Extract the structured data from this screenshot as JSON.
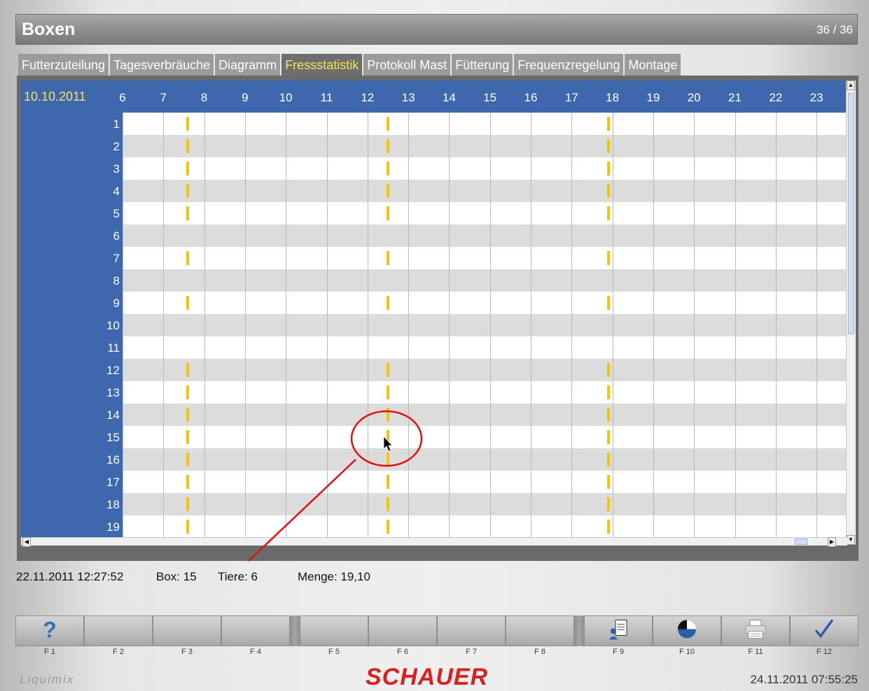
{
  "window": {
    "title": "Boxen",
    "page_indicator": "36 / 36"
  },
  "tabs": [
    {
      "label": "Futterzuteilung",
      "active": false
    },
    {
      "label": "Tagesverbräuche",
      "active": false
    },
    {
      "label": "Diagramm",
      "active": false
    },
    {
      "label": "Fressstatistik",
      "active": true
    },
    {
      "label": "Protokoll Mast",
      "active": false
    },
    {
      "label": "Fütterung",
      "active": false
    },
    {
      "label": "Frequenzregelung",
      "active": false
    },
    {
      "label": "Montage",
      "active": false
    }
  ],
  "grid": {
    "date": "10.10.2011",
    "hours": [
      "6",
      "7",
      "8",
      "9",
      "10",
      "11",
      "12",
      "13",
      "14",
      "15",
      "16",
      "17",
      "18",
      "19",
      "20",
      "21",
      "22",
      "23"
    ],
    "rows": [
      "1",
      "2",
      "3",
      "4",
      "5",
      "6",
      "7",
      "8",
      "9",
      "10",
      "11",
      "12",
      "13",
      "14",
      "15",
      "16",
      "17",
      "18",
      "19"
    ],
    "feeding_events": [
      {
        "box": 1,
        "hours": [
          7.6,
          12.5,
          17.9
        ]
      },
      {
        "box": 2,
        "hours": [
          7.6,
          12.5,
          17.9
        ]
      },
      {
        "box": 3,
        "hours": [
          7.6,
          12.5,
          17.9
        ]
      },
      {
        "box": 4,
        "hours": [
          7.6,
          12.5,
          17.9
        ]
      },
      {
        "box": 5,
        "hours": [
          7.6,
          12.5,
          17.9
        ]
      },
      {
        "box": 7,
        "hours": [
          7.6,
          12.5,
          17.9
        ]
      },
      {
        "box": 9,
        "hours": [
          7.6,
          12.5,
          17.9
        ]
      },
      {
        "box": 12,
        "hours": [
          7.6,
          12.5,
          17.9
        ]
      },
      {
        "box": 13,
        "hours": [
          7.6,
          12.5,
          17.9
        ]
      },
      {
        "box": 14,
        "hours": [
          7.6,
          12.5,
          17.9
        ]
      },
      {
        "box": 15,
        "hours": [
          7.6,
          12.5,
          17.9
        ]
      },
      {
        "box": 16,
        "hours": [
          7.6,
          12.5,
          17.9
        ]
      },
      {
        "box": 17,
        "hours": [
          7.6,
          12.5,
          17.9
        ]
      },
      {
        "box": 18,
        "hours": [
          7.6,
          12.5,
          17.9
        ]
      },
      {
        "box": 19,
        "hours": [
          7.6,
          12.5,
          17.9
        ]
      }
    ]
  },
  "status": {
    "timestamp": "22.11.2011 12:27:52",
    "box": "Box: 15",
    "tiere": "Tiere: 6",
    "menge": "Menge: 19,10"
  },
  "function_keys": [
    {
      "label": "F 1",
      "icon": "help-icon"
    },
    {
      "label": "F 2",
      "icon": ""
    },
    {
      "label": "F 3",
      "icon": ""
    },
    {
      "label": "F 4",
      "icon": ""
    },
    {
      "label": "F 5",
      "icon": ""
    },
    {
      "label": "F 6",
      "icon": ""
    },
    {
      "label": "F 7",
      "icon": ""
    },
    {
      "label": "F 8",
      "icon": ""
    },
    {
      "label": "F 9",
      "icon": "user-document-icon"
    },
    {
      "label": "F 10",
      "icon": "pie-chart-icon"
    },
    {
      "label": "F 11",
      "icon": "printer-icon"
    },
    {
      "label": "F 12",
      "icon": "checkmark-icon"
    }
  ],
  "footer": {
    "left_brand": "Liquimix",
    "center_brand": "SCHAUER",
    "clock": "24.11.2011 07:55:25"
  },
  "colors": {
    "header_blue": "#3f67ad",
    "active_tab_text": "#f6e35a",
    "feeding_mark": "#f2c40c",
    "annotation_red": "#e01010"
  }
}
